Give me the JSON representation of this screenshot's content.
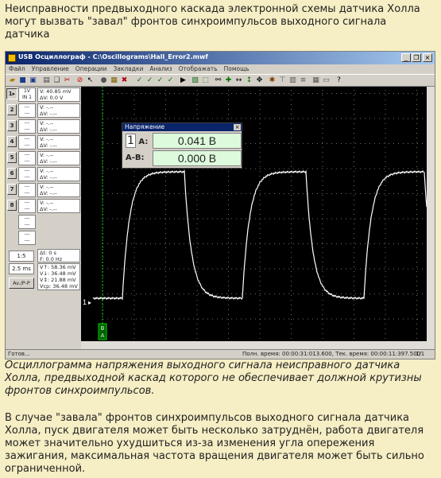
{
  "article": {
    "intro": "Неисправности предвыходного каскада электронной схемы датчика Холла могут вызвать \"завал\" фронтов синхроимпульсов выходного сигнала датчика",
    "caption": "Осциллограмма напряжения выходного сигнала неисправного датчика Холла, предвыходной каскад которого не обеспечивает должной крутизны фронтов синхроимпульсов.",
    "body": "В случае \"завала\" фронтов синхроимпульсов выходного сигнала датчика Холла, пуск двигателя может быть несколько затруднён, работа двигателя может значительно ухудшиться из-за изменения угла опережения зажигания, максимальная частота вращения двигателя может быть сильно ограниченной."
  },
  "window": {
    "title": "USB Осциллограф - C:\\Oscillograms\\Hall_Error2.mwf",
    "minimize": "_",
    "restore": "❐",
    "close": "×",
    "menu": [
      "Файл",
      "Управление",
      "Операции",
      "Закладки",
      "Анализ",
      "Отображать",
      "Помощь"
    ]
  },
  "channels": {
    "ch1_button": "1",
    "ch1_info": [
      "1V",
      "IN 1"
    ],
    "buttons": [
      "2",
      "3",
      "4",
      "5",
      "6",
      "7",
      "8"
    ],
    "dash": "---",
    "meas1": [
      "V: 40.85 mV",
      "ΔV: 0.0 V"
    ],
    "meas_empty": [
      "V: -.--",
      "ΔV: -.--"
    ],
    "time_meas": [
      "Δt: 0 s",
      "F: 0.0 Hz"
    ],
    "stats": [
      "V↑: 58.36 mV",
      "V↓: 36.48 mV",
      "V↕: 21.88 mV",
      "Vср: 36.48 mV"
    ],
    "scale": "1:5",
    "timebase": "2.5 ms",
    "mode": "Av./P-P"
  },
  "popup": {
    "title": "Напряжение",
    "close": "×",
    "channel": "1",
    "row1_label": "A:",
    "row1_value": "0.041 В",
    "row2_label": "A-B:",
    "row2_value": "0.000 В"
  },
  "scope": {
    "channel_marker": "1",
    "cursor_labels": [
      "B",
      "A"
    ],
    "bg": "#000000",
    "trace_color": "#ffffff",
    "cursor_color": "#00d000"
  },
  "status": {
    "ready": "Готов...",
    "times": "Полн. время: 00:00:31:013.600, Тек. время: 00:00:11:397.500",
    "page": "1/1"
  }
}
